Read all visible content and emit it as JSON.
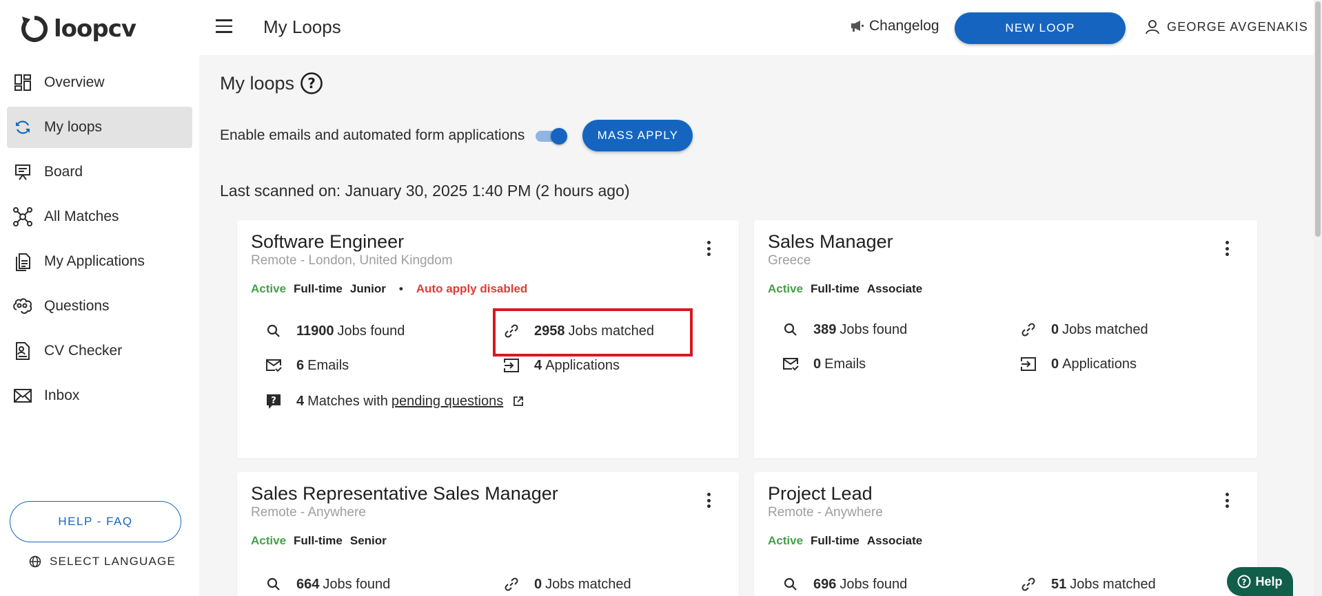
{
  "app": {
    "brand": "loopcv",
    "accent_color": "#1565c0"
  },
  "sidebar": {
    "items": [
      {
        "label": "Overview",
        "icon": "dashboard-icon"
      },
      {
        "label": "My loops",
        "icon": "sync-icon",
        "active": true
      },
      {
        "label": "Board",
        "icon": "board-icon"
      },
      {
        "label": "All Matches",
        "icon": "network-icon"
      },
      {
        "label": "My Applications",
        "icon": "documents-icon"
      },
      {
        "label": "Questions",
        "icon": "brain-icon"
      },
      {
        "label": "CV Checker",
        "icon": "cv-icon"
      },
      {
        "label": "Inbox",
        "icon": "mail-icon"
      }
    ],
    "help_faq": "HELP - FAQ",
    "select_language": "SELECT LANGUAGE"
  },
  "header": {
    "title": "My Loops",
    "changelog": "Changelog",
    "new_loop": "NEW LOOP",
    "user": "GEORGE AVGENAKIS"
  },
  "main": {
    "section_title": "My loops",
    "enable_label": "Enable emails and automated form applications",
    "toggle_on": true,
    "mass_apply": "MASS APPLY",
    "last_scanned": "Last scanned on: January 30, 2025 1:40 PM (2 hours ago)"
  },
  "loops": [
    {
      "title": "Software Engineer",
      "location": "Remote - London, United Kingdom",
      "status": "Active",
      "type": "Full-time",
      "level": "Junior",
      "dot": "•",
      "warning": "Auto apply disabled",
      "jobs_found": "11900",
      "jobs_found_label": "Jobs found",
      "jobs_matched": "2958",
      "jobs_matched_label": "Jobs matched",
      "emails": "6",
      "emails_label": "Emails",
      "applications": "4",
      "applications_label": "Applications",
      "pending": "4",
      "pending_prefix": "Matches with",
      "pending_link": "pending questions"
    },
    {
      "title": "Sales Manager",
      "location": "Greece",
      "status": "Active",
      "type": "Full-time",
      "level": "Associate",
      "jobs_found": "389",
      "jobs_found_label": "Jobs found",
      "jobs_matched": "0",
      "jobs_matched_label": "Jobs matched",
      "emails": "0",
      "emails_label": "Emails",
      "applications": "0",
      "applications_label": "Applications"
    },
    {
      "title": "Sales Representative Sales Manager",
      "location": "Remote - Anywhere",
      "status": "Active",
      "type": "Full-time",
      "level": "Senior",
      "jobs_found": "664",
      "jobs_found_label": "Jobs found",
      "jobs_matched": "0",
      "jobs_matched_label": "Jobs matched"
    },
    {
      "title": "Project Lead",
      "location": "Remote - Anywhere",
      "status": "Active",
      "type": "Full-time",
      "level": "Associate",
      "jobs_found": "696",
      "jobs_found_label": "Jobs found",
      "jobs_matched": "51",
      "jobs_matched_label": "Jobs matched"
    }
  ],
  "help_widget": "Help"
}
